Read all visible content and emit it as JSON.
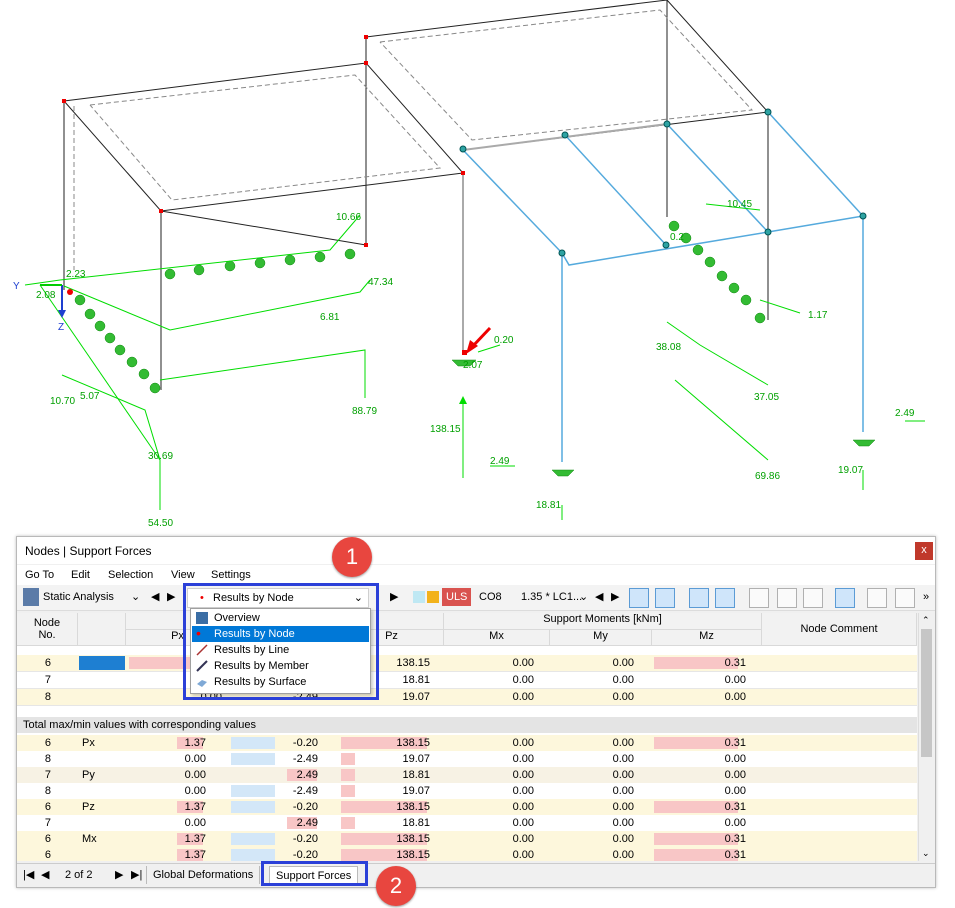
{
  "viewport": {
    "load_labels": [
      "10.66",
      "2.23",
      "2.08",
      "47.34",
      "6.81",
      "88.79",
      "10.70",
      "5.07",
      "30.69",
      "54.50",
      "0.20",
      "138.15",
      "2.49",
      "18.81",
      "10.45",
      "1.17",
      "38.08",
      "37.05",
      "69.86",
      "2.49",
      "19.07",
      "2.07",
      "0.2"
    ],
    "axis_labels": {
      "y": "Y",
      "z": "Z"
    },
    "colors": {
      "support": "#33bb33",
      "structure": "#222222",
      "beam_blue": "#55aadd",
      "load": "#00dd00",
      "node": "#e00000"
    }
  },
  "panel": {
    "title": "Nodes | Support Forces",
    "close_label": "x",
    "menu": [
      "Go To",
      "Edit",
      "Selection",
      "View",
      "Settings"
    ],
    "toolbar": {
      "analysis": "Static Analysis",
      "results_by": "Results by Node",
      "uls_badge": "ULS",
      "combo_code": "CO8",
      "combo_value": "1.35 * LC1...",
      "overflow": "»"
    },
    "headers": {
      "node_no": "Node\nNo.",
      "px": "Px",
      "pz": "Pz",
      "moments_group": "Support Moments [kNm]",
      "mx": "Mx",
      "my": "My",
      "mz": "Mz",
      "comment": "Node Comment"
    },
    "rows": [
      {
        "node": "6",
        "px": "",
        "py": "",
        "pz": "138.15",
        "mx": "0.00",
        "my": "0.00",
        "mz": "0.31"
      },
      {
        "node": "7",
        "px": "0.",
        "py": "",
        "pz": "18.81",
        "mx": "0.00",
        "my": "0.00",
        "mz": "0.00"
      },
      {
        "node": "8",
        "px": "0.00",
        "py": "-2.49",
        "pz": "19.07",
        "mx": "0.00",
        "my": "0.00",
        "mz": "0.00"
      }
    ],
    "section_title": "Total max/min values with corresponding values",
    "maxmin_rows": [
      {
        "node": "6",
        "type": "Px",
        "px": "1.37",
        "py": "-0.20",
        "pz": "138.15",
        "mx": "0.00",
        "my": "0.00",
        "mz": "0.31"
      },
      {
        "node": "8",
        "type": "",
        "px": "0.00",
        "py": "-2.49",
        "pz": "19.07",
        "mx": "0.00",
        "my": "0.00",
        "mz": "0.00"
      },
      {
        "node": "7",
        "type": "Py",
        "px": "0.00",
        "py": "2.49",
        "pz": "18.81",
        "mx": "0.00",
        "my": "0.00",
        "mz": "0.00"
      },
      {
        "node": "8",
        "type": "",
        "px": "0.00",
        "py": "-2.49",
        "pz": "19.07",
        "mx": "0.00",
        "my": "0.00",
        "mz": "0.00"
      },
      {
        "node": "6",
        "type": "Pz",
        "px": "1.37",
        "py": "-0.20",
        "pz": "138.15",
        "mx": "0.00",
        "my": "0.00",
        "mz": "0.31"
      },
      {
        "node": "7",
        "type": "",
        "px": "0.00",
        "py": "2.49",
        "pz": "18.81",
        "mx": "0.00",
        "my": "0.00",
        "mz": "0.00"
      },
      {
        "node": "6",
        "type": "Mx",
        "px": "1.37",
        "py": "-0.20",
        "pz": "138.15",
        "mx": "0.00",
        "my": "0.00",
        "mz": "0.31"
      },
      {
        "node": "6",
        "type": "",
        "px": "1.37",
        "py": "-0.20",
        "pz": "138.15",
        "mx": "0.00",
        "my": "0.00",
        "mz": "0.31"
      }
    ],
    "dropdown_items": [
      "Overview",
      "Results by Node",
      "Results by Line",
      "Results by Member",
      "Results by Surface"
    ],
    "pager": "2 of 2",
    "tabs": [
      "Global Deformations",
      "Support Forces"
    ],
    "callouts": [
      "1",
      "2"
    ]
  }
}
